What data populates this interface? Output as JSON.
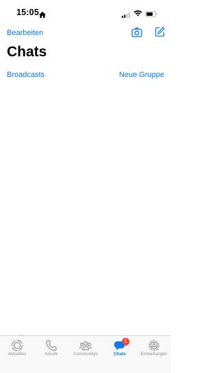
{
  "status_bar": {
    "time": "15:05",
    "icons": [
      "home-icon",
      "cellular-signal-icon",
      "wifi-icon",
      "battery-icon"
    ]
  },
  "header": {
    "edit_label": "Bearbeiten",
    "title": "Chats",
    "actions": [
      "camera-icon",
      "compose-icon"
    ]
  },
  "links": {
    "broadcasts": "Broadcasts",
    "new_group": "Neue Gruppe"
  },
  "tab_bar": {
    "tabs": [
      {
        "label": "Aktuelles",
        "icon": "updates-icon"
      },
      {
        "label": "Anrufe",
        "icon": "phone-icon"
      },
      {
        "label": "Communitys",
        "icon": "communities-icon"
      },
      {
        "label": "Chats",
        "icon": "chats-icon",
        "badge": "1",
        "active": true
      },
      {
        "label": "Einstellungen",
        "icon": "settings-gear-icon"
      }
    ]
  },
  "colors": {
    "accent": "#007aff",
    "badge": "#ff3b30",
    "tab_inactive": "#8e8e93"
  }
}
